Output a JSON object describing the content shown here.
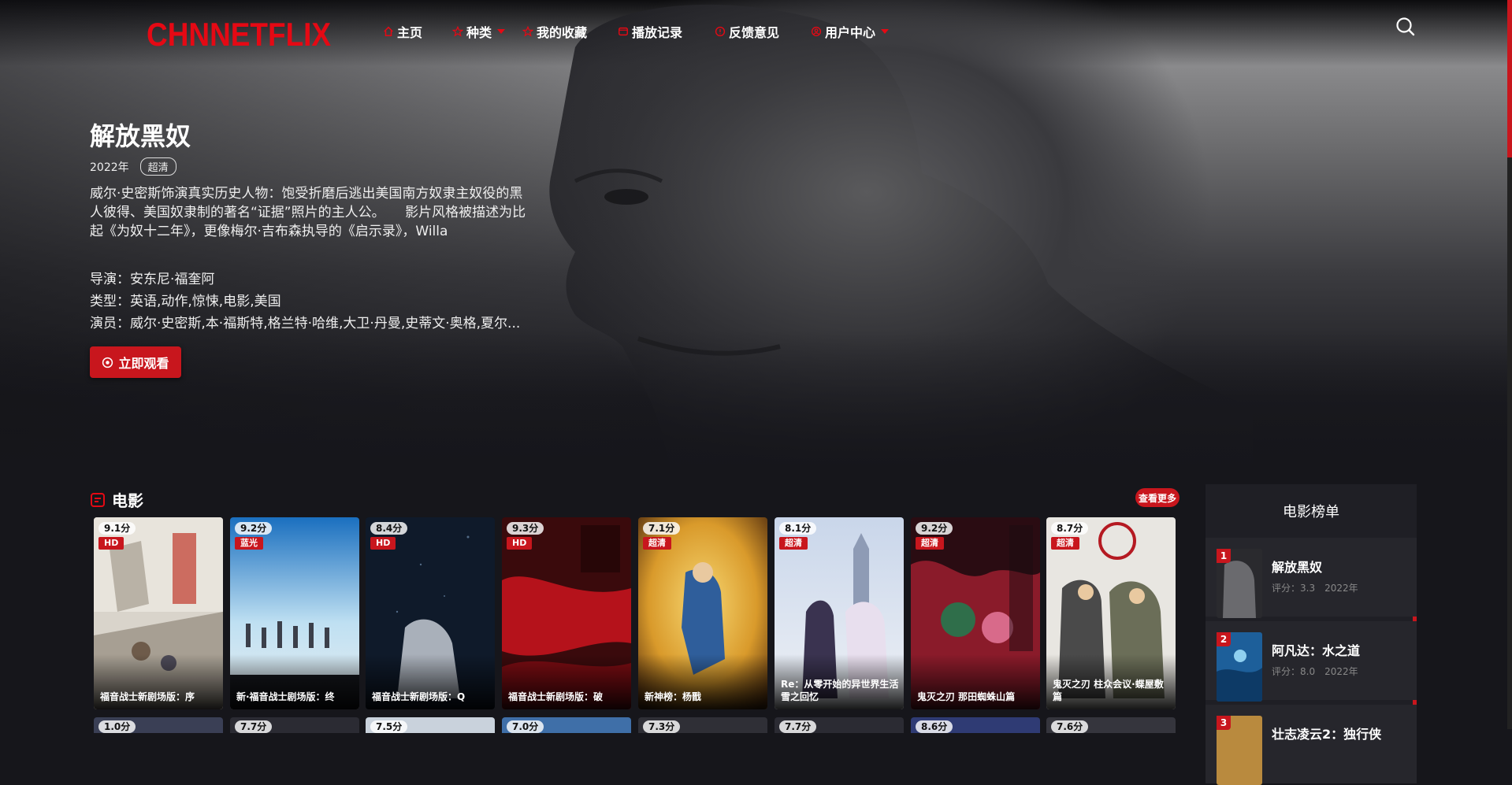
{
  "site": {
    "logo": "CHNNETFLIX"
  },
  "nav": {
    "items": [
      {
        "label": "主页",
        "icon": "home-icon"
      },
      {
        "label": "种类",
        "icon": "star-icon",
        "dropdown": true
      },
      {
        "label": "我的收藏",
        "icon": "star-icon"
      },
      {
        "label": "播放记录",
        "icon": "history-icon"
      },
      {
        "label": "反馈意见",
        "icon": "info-icon"
      },
      {
        "label": "用户中心",
        "icon": "user-icon",
        "dropdown": true
      }
    ],
    "search_icon": "search-icon"
  },
  "hero": {
    "title": "解放黑奴",
    "year": "2022年",
    "quality": "超清",
    "description": "威尔·史密斯饰演真实历史人物：饱受折磨后逃出美国南方奴隶主奴役的黑人彼得、美国奴隶制的著名“证据”照片的主人公。　　影片风格被描述为比起《为奴十二年》，更像梅尔·吉布森执导的《启示录》，Willa",
    "director": "导演：安东尼·福奎阿",
    "genre": "类型：英语,动作,惊悚,电影,美国",
    "cast": "演员：威尔·史密斯,本·福斯特,格兰特·哈维,大卫·丹曼,史蒂文·奥格,夏尔...",
    "watch_label": "立即观看"
  },
  "movies_section": {
    "title": "电影",
    "more_label": "查看更多",
    "cards": [
      {
        "score": "9.1分",
        "quality": "HD",
        "title": "福音战士新剧场版：序"
      },
      {
        "score": "9.2分",
        "quality": "蓝光",
        "title": "新·福音战士剧场版：终"
      },
      {
        "score": "8.4分",
        "quality": "HD",
        "title": "福音战士新剧场版：Q"
      },
      {
        "score": "9.3分",
        "quality": "HD",
        "title": "福音战士新剧场版：破"
      },
      {
        "score": "7.1分",
        "quality": "超清",
        "title": "新神榜：杨戬"
      },
      {
        "score": "8.1分",
        "quality": "超清",
        "title": "Re：从零开始的异世界生活 雪之回忆"
      },
      {
        "score": "9.2分",
        "quality": "超清",
        "title": "鬼灭之刃 那田蜘蛛山篇"
      },
      {
        "score": "8.7分",
        "quality": "超清",
        "title": "鬼灭之刃 柱众会议·蝶屋敷篇"
      }
    ],
    "row2_scores": [
      "1.0分",
      "7.7分",
      "7.5分",
      "7.0分",
      "7.3分",
      "7.7分",
      "8.6分",
      "7.6分"
    ]
  },
  "ranking": {
    "title": "电影榜单",
    "items": [
      {
        "rank": "1",
        "title": "解放黑奴",
        "score": "评分：3.3",
        "year": "2022年"
      },
      {
        "rank": "2",
        "title": "阿凡达：水之道",
        "score": "评分：8.0",
        "year": "2022年"
      },
      {
        "rank": "3",
        "title": "壮志凌云2：独行侠",
        "score": "",
        "year": ""
      }
    ]
  },
  "colors": {
    "accent": "#c8161d",
    "logo": "#e50914",
    "background": "#16161b"
  }
}
